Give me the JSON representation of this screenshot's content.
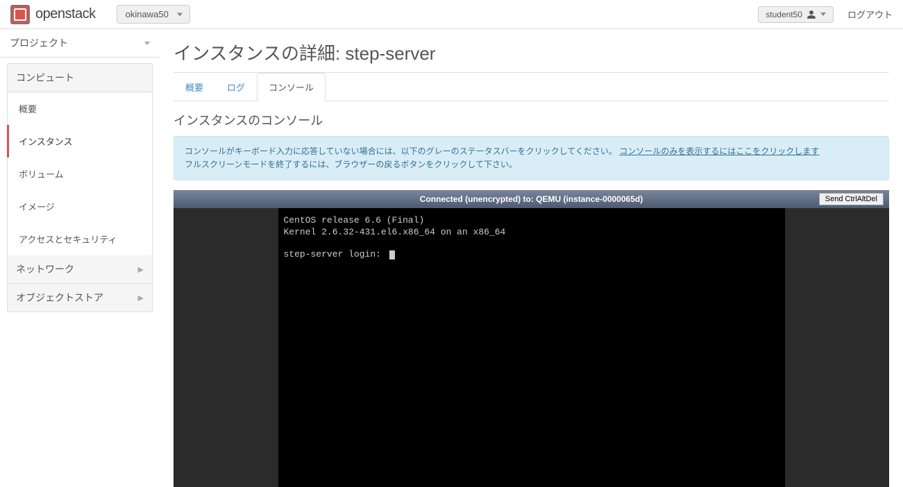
{
  "header": {
    "brand": "openstack",
    "project_selector": "okinawa50",
    "user": "student50",
    "logout": "ログアウト"
  },
  "sidebar": {
    "title": "プロジェクト",
    "groups": {
      "compute": {
        "label": "コンピュート",
        "items": {
          "overview": "概要",
          "instances": "インスタンス",
          "volumes": "ボリューム",
          "images": "イメージ",
          "access_security": "アクセスとセキュリティ"
        }
      },
      "network": {
        "label": "ネットワーク"
      },
      "object_store": {
        "label": "オブジェクトストア"
      }
    }
  },
  "page": {
    "title": "インスタンスの詳細: step-server",
    "tabs": {
      "overview": "概要",
      "log": "ログ",
      "console": "コンソール"
    },
    "console_heading": "インスタンスのコンソール",
    "alert": {
      "line1_pre": "コンソールがキーボード入力に応答していない場合には、以下のグレーのステータスバーをクリックしてください。",
      "line1_link": "コンソールのみを表示するにはここをクリックします",
      "line2": "フルスクリーンモードを終了するには、ブラウザーの戻るボタンをクリックして下さい。"
    },
    "vnc": {
      "status": "Connected (unencrypted) to: QEMU (instance-0000065d)",
      "ctrlaltdel": "Send CtrlAltDel",
      "terminal": {
        "line1": "CentOS release 6.6 (Final)",
        "line2": "Kernel 2.6.32-431.el6.x86_64 on an x86_64",
        "line3": "step-server login: "
      }
    }
  }
}
